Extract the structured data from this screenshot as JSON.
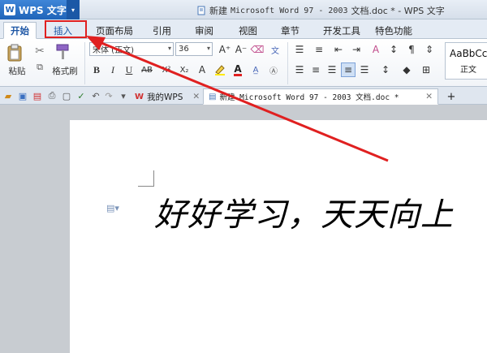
{
  "app": {
    "name": "WPS 文字",
    "logo": "W",
    "dropdown_icon": "▾"
  },
  "window": {
    "doc_title_prefix": "新建 ",
    "doc_title_main": "Microsoft Word 97 - 2003",
    "doc_title_suffix": " 文档.doc * - WPS 文字"
  },
  "tabs": [
    {
      "label": "开始",
      "active": true
    },
    {
      "label": "插入",
      "active": false,
      "highlighted": true
    },
    {
      "label": "页面布局"
    },
    {
      "label": "引用"
    },
    {
      "label": "审阅"
    },
    {
      "label": "视图"
    },
    {
      "label": "章节"
    },
    {
      "label": "开发工具"
    },
    {
      "label": "特色功能"
    }
  ],
  "ribbon": {
    "paste_label": "粘贴",
    "format_painter_label": "格式刷",
    "font_name": "宋体 (正文)",
    "font_size": "36",
    "bold": "B",
    "italic": "I",
    "underline": "U",
    "strike": "AB",
    "superscript": "X²",
    "subscript": "X₂",
    "grow_font": "A⁺",
    "shrink_font": "A⁻",
    "font_color": "A",
    "styles_sample": "AaBbCc",
    "styles_name": "正文"
  },
  "doc_tabs": [
    {
      "label": "我的WPS",
      "icon": "wps-icon"
    },
    {
      "label": "新建 Microsoft Word 97 - 2003 文档.doc *",
      "icon": "doc-icon",
      "current": true
    }
  ],
  "document": {
    "text": "好好学习，天天向上"
  },
  "colors": {
    "accent": "#1f64b9",
    "annotation": "#e02020"
  }
}
